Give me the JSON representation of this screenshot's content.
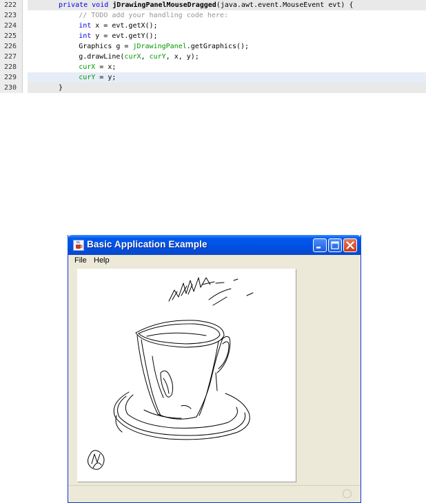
{
  "code": {
    "lines": [
      {
        "num": "222",
        "parts": [
          {
            "t": "private void ",
            "c": "kw"
          },
          {
            "t": "jDrawingPanelMouseDragged",
            "c": "bold"
          },
          {
            "t": "(java.awt.event.MouseEvent evt) {",
            "c": ""
          }
        ],
        "indent": 0,
        "state": "hl"
      },
      {
        "num": "223",
        "parts": [
          {
            "t": "// TODO add your handling code here:",
            "c": "cm"
          }
        ],
        "indent": 4,
        "state": ""
      },
      {
        "num": "224",
        "parts": [
          {
            "t": "int",
            "c": "kw"
          },
          {
            "t": " x = evt.getX();",
            "c": ""
          }
        ],
        "indent": 4,
        "state": ""
      },
      {
        "num": "225",
        "parts": [
          {
            "t": "int",
            "c": "kw"
          },
          {
            "t": " y = evt.getY();",
            "c": ""
          }
        ],
        "indent": 4,
        "state": ""
      },
      {
        "num": "226",
        "parts": [
          {
            "t": "Graphics g = ",
            "c": ""
          },
          {
            "t": "jDrawingPanel",
            "c": "fld"
          },
          {
            "t": ".getGraphics();",
            "c": ""
          }
        ],
        "indent": 4,
        "state": ""
      },
      {
        "num": "227",
        "parts": [
          {
            "t": "g.drawLine(",
            "c": ""
          },
          {
            "t": "curX",
            "c": "fld"
          },
          {
            "t": ", ",
            "c": ""
          },
          {
            "t": "curY",
            "c": "fld"
          },
          {
            "t": ", x, y);",
            "c": ""
          }
        ],
        "indent": 4,
        "state": ""
      },
      {
        "num": "228",
        "parts": [
          {
            "t": "curX",
            "c": "fld"
          },
          {
            "t": " = x;",
            "c": ""
          }
        ],
        "indent": 4,
        "state": ""
      },
      {
        "num": "229",
        "parts": [
          {
            "t": "curY",
            "c": "fld"
          },
          {
            "t": " = y;",
            "c": ""
          }
        ],
        "indent": 4,
        "state": "cur"
      },
      {
        "num": "230",
        "parts": [
          {
            "t": "}",
            "c": ""
          }
        ],
        "indent": 0,
        "state": "hl"
      }
    ]
  },
  "window": {
    "title": "Basic Application Example",
    "menu": [
      "File",
      "Help"
    ]
  },
  "colors": {
    "keyword": "#0000e6",
    "comment": "#969696",
    "field": "#009900",
    "titlebar": "#0054e3",
    "close_button": "#d9532f"
  },
  "icons": {
    "app": "java-cup-icon",
    "minimize": "minimize-icon",
    "maximize": "maximize-icon",
    "close": "close-icon",
    "status": "busy-indicator-icon"
  }
}
